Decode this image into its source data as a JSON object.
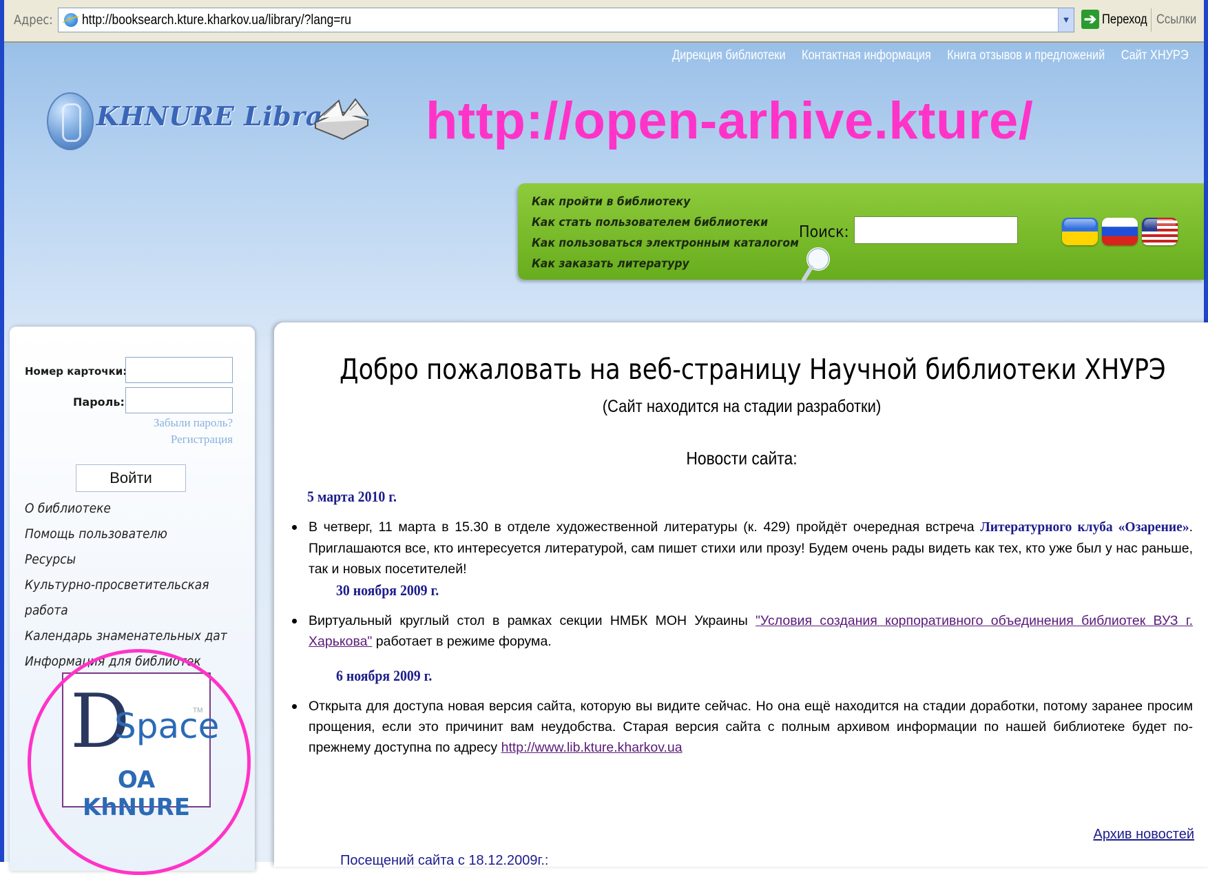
{
  "browser": {
    "address_label": "Адрес:",
    "url": "http://booksearch.kture.kharkov.ua/library/?lang=ru",
    "go_label": "Переход",
    "links_label": "Ссылки"
  },
  "top_links": [
    "Дирекция библиотеки",
    "Контактная информация",
    "Книга отзывов и предложений",
    "Сайт ХНУРЭ"
  ],
  "logo_text": "KHNURE Library",
  "overlay_url": "http://open-arhive.kture/",
  "help_panel": {
    "links": [
      "Как пройти в библиотеку",
      "Как стать пользователем библиотеки",
      "Как пользоваться электронным каталогом",
      "Как заказать литературу"
    ],
    "search_label": "Поиск:",
    "search_value": ""
  },
  "login": {
    "card_label": "Номер карточки:",
    "password_label": "Пароль:",
    "forgot": "Забыли пароль?",
    "register": "Регистрация",
    "button": "Войти"
  },
  "menu": [
    "О библиотеке",
    "Помощь пользователю",
    "Ресурсы",
    "Культурно-просветительская",
    "работа",
    "Календарь знаменательных дат",
    "Информация для библиотек"
  ],
  "dspace": {
    "letter": "D",
    "word": "Space",
    "tm": "TM",
    "caption": "OA KhNURE"
  },
  "main": {
    "title": "Добро пожаловать на веб-страницу Научной библиотеки ХНУРЭ",
    "subtitle": "(Сайт находится на стадии разработки)",
    "news_heading": "Новости сайта:",
    "items": [
      {
        "date": "5 марта 2010 г.",
        "text_before": "В четверг, 11 марта в 15.30 в отделе художественной литературы (к. 429) пройдёт очередная встреча ",
        "highlight": "Литературного клуба «Озарение»",
        "text_after": ". Приглашаются все, кто интересуется литературой, сам пишет стихи или прозу! Будем очень рады видеть как тех, кто уже был у нас раньше, так и новых посетителей!"
      },
      {
        "date": "30 ноября 2009 г.",
        "text_before": "Виртуальный круглый стол в рамках секции НМБК МОН Украины ",
        "link": "\"Условия создания корпоративного объединения библиотек ВУЗ г. Харькова\"",
        "text_after": " работает в режиме форума."
      },
      {
        "date": "6 ноября 2009 г.",
        "text_before": "Открыта для доступа новая версия сайта, которую вы видите сейчас. Но она ещё находится на стадии доработки, потому заранее просим прощения, если это причинит вам неудобства. Старая версия сайта с полным архивом информации по нашей библиотеке будет по-прежнему доступна по адресу ",
        "link": "http://www.lib.kture.kharkov.ua",
        "text_after": ""
      }
    ],
    "archive": "Архив новостей",
    "visits": "Посещений сайта с 18.12.2009г.:"
  },
  "colors": {
    "highlight": "#ff33c8",
    "link": "#1c1c8c",
    "panel_green": "#7dbd2d"
  }
}
